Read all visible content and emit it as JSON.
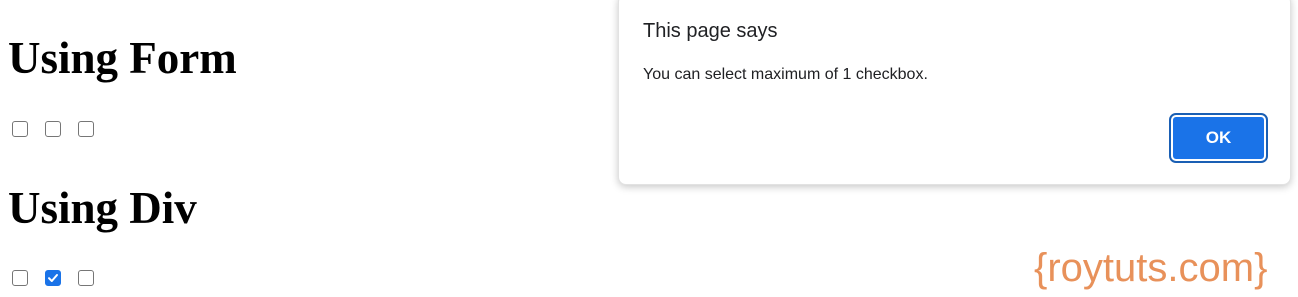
{
  "page": {
    "form_section": {
      "heading": "Using Form",
      "checkboxes": [
        {
          "checked": false
        },
        {
          "checked": false
        },
        {
          "checked": false
        }
      ]
    },
    "div_section": {
      "heading": "Using Div",
      "checkboxes": [
        {
          "checked": false
        },
        {
          "checked": true
        },
        {
          "checked": false
        }
      ]
    },
    "watermark": "{roytuts.com}"
  },
  "dialog": {
    "title": "This page says",
    "message": "You can select maximum of 1 checkbox.",
    "ok_label": "OK"
  },
  "colors": {
    "accent": "#1a73e8",
    "watermark": "#e8915a",
    "text": "#202124"
  },
  "icons": {
    "checkmark": "check-icon"
  }
}
